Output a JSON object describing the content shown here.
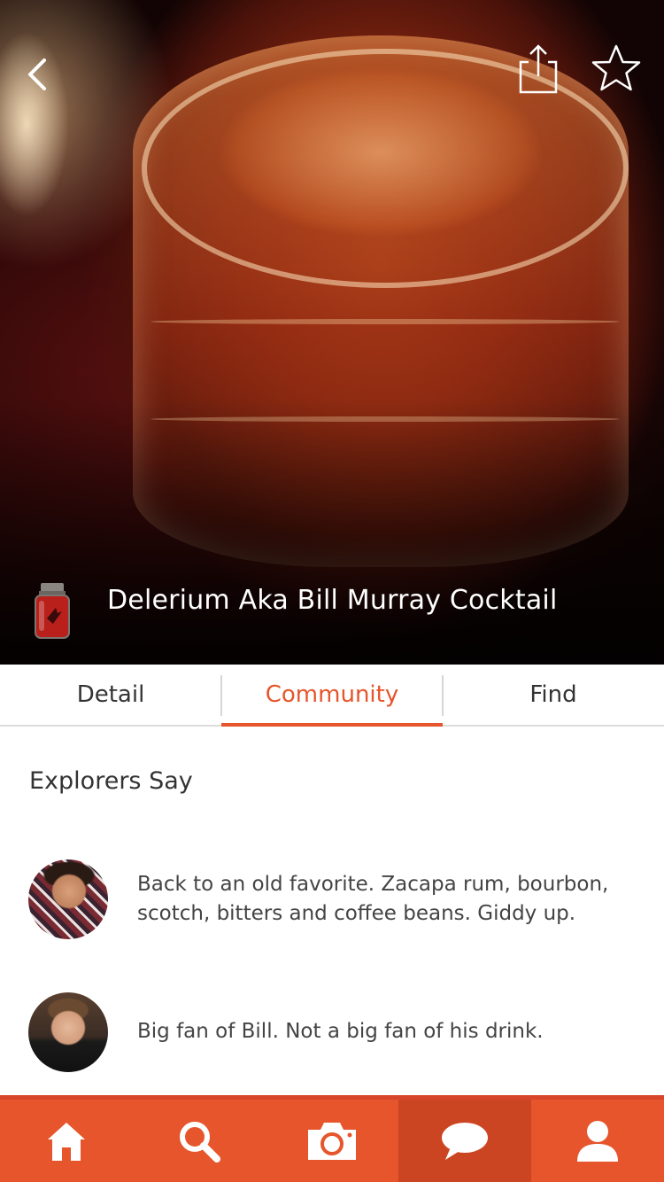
{
  "header": {
    "back_icon": "chevron-left-icon",
    "share_icon": "share-icon",
    "favorite_icon": "star-outline-icon"
  },
  "drink": {
    "title": "Delerium Aka Bill Murray Cocktail",
    "category_icon": "jar-icon"
  },
  "tabs": [
    {
      "label": "Detail",
      "active": false
    },
    {
      "label": "Community",
      "active": true
    },
    {
      "label": "Find",
      "active": false
    }
  ],
  "community": {
    "section_title": "Explorers Say",
    "comments": [
      {
        "text": "Back to an old favorite. Zacapa rum, bourbon, scotch, bitters and coffee beans. Giddy up."
      },
      {
        "text": "Big fan of Bill. Not a big fan of his drink."
      }
    ]
  },
  "bottom_nav": {
    "items": [
      {
        "icon": "home-icon",
        "active": false
      },
      {
        "icon": "search-icon",
        "active": false
      },
      {
        "icon": "camera-icon",
        "active": false
      },
      {
        "icon": "chat-icon",
        "active": true
      },
      {
        "icon": "profile-icon",
        "active": false
      }
    ]
  },
  "colors": {
    "accent": "#e6552b",
    "accent_active": "#cc4522",
    "text": "#333333"
  }
}
